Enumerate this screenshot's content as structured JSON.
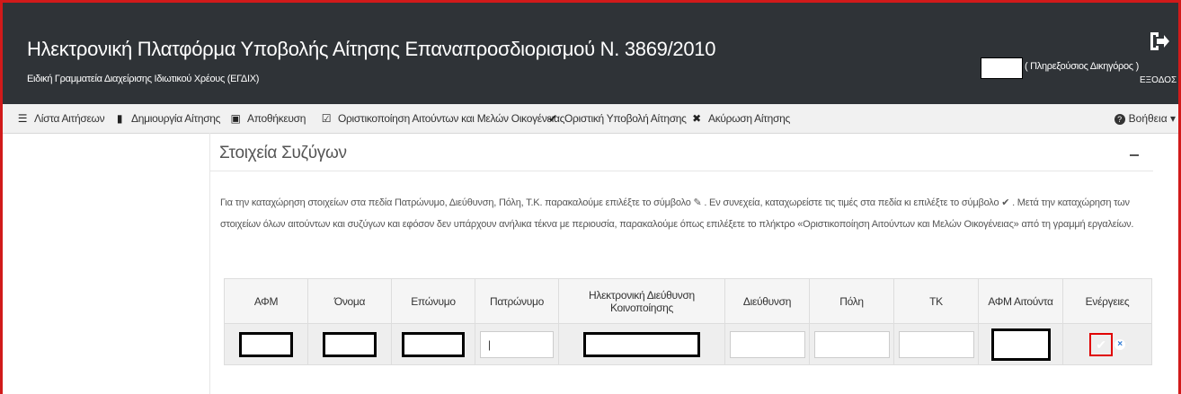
{
  "header": {
    "title": "Ηλεκτρονική Πλατφόρμα Υποβολής Αίτησης Επαναπροσδιορισμού Ν. 3869/2010",
    "subtitle": "Ειδική Γραμματεία Διαχείρισης Ιδιωτικού Χρέους (ΕΓΔΙΧ)",
    "user_role": "( Πληρεξούσιος Δικηγόρος )",
    "logout_label": "ΕΞΟΔΟΣ"
  },
  "toolbar": {
    "items": [
      {
        "label": "Λίστα Αιτήσεων",
        "icon": "list-icon"
      },
      {
        "label": "Δημιουργία Αίτησης",
        "icon": "file-icon"
      },
      {
        "label": "Αποθήκευση",
        "icon": "save-icon"
      },
      {
        "label": "Οριστικοποίηση Αιτούντων και Μελών Οικογένειας",
        "icon": "check-square-icon"
      },
      {
        "label": "Οριστική Υποβολή Αίτησης",
        "icon": "check-icon"
      },
      {
        "label": "Ακύρωση Αίτησης",
        "icon": "close-icon"
      }
    ],
    "help_label": "Βοήθεια"
  },
  "section": {
    "title": "Στοιχεία Συζύγων",
    "instructions": "Για την καταχώρηση στοιχείων στα πεδία Πατρώνυμο, Διεύθυνση, Πόλη, Τ.Κ. παρακαλούμε επιλέξτε το σύμβολο ✎ . Εν συνεχεία, καταχωρείστε τις τιμές στα πεδία κι επιλέξτε το σύμβολο ✔ . Μετά την καταχώρηση των στοιχείων όλων αιτούντων και συζύγων και εφόσον δεν υπάρχουν ανήλικα τέκνα με περιουσία, παρακαλούμε όπως επιλέξετε το πλήκτρο «Οριστικοποίηση Αιτούντων και Μελών Οικογένειας» από τη γραμμή εργαλείων."
  },
  "table": {
    "headers": [
      "ΑΦΜ",
      "Όνομα",
      "Επώνυμο",
      "Πατρώνυμο",
      "Ηλεκτρονική Διεύθυνση Κοινοποίησης",
      "Διεύθυνση",
      "Πόλη",
      "ΤΚ",
      "ΑΦΜ Αιτούντα",
      "Ενέργειες"
    ],
    "row": {
      "patronymic_value": "|"
    }
  },
  "colors": {
    "header_bg": "#2f3337",
    "accent": "#2b7ad6",
    "highlight": "#e00000"
  }
}
